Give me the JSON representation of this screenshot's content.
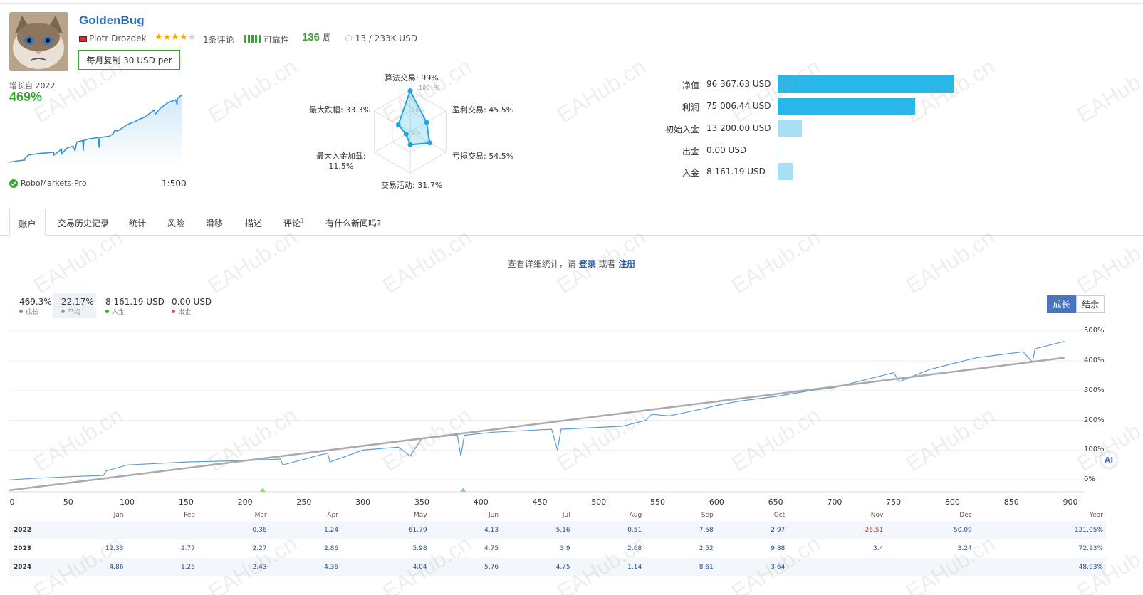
{
  "profile": {
    "title": "GoldenBug",
    "author": "Piotr Drozdek",
    "rating": 3.5,
    "reviews": "1条评论",
    "reliability_label": "可靠性",
    "weeks": "136",
    "weeks_unit": "周",
    "subscribers": "13 / 233K USD",
    "subscribe_label": "每月复制 30 USD per",
    "growth_since": "增长自 2022",
    "growth_value": "469%",
    "broker": "RoboMarkets-Pro",
    "leverage": "1:500"
  },
  "radar": {
    "algo": "算法交易: 99%",
    "profit_trades": "盈利交易: 45.5%",
    "loss_trades": "亏损交易: 54.5%",
    "activity": "交易活动: 31.7%",
    "max_load_a": "最大入金加载:",
    "max_load_b": "11.5%",
    "max_drawdown": "最大跌幅: 33.3%",
    "ring_100": "100+%",
    "ring_50": "50%",
    "ring_0": "0%",
    "values": [
      0.99,
      0.455,
      0.545,
      0.317,
      0.115,
      0.333
    ]
  },
  "stats": [
    {
      "label": "净值",
      "value": "96 367.63 USD",
      "amount": 96367.63,
      "color": "#29b6e8"
    },
    {
      "label": "利润",
      "value": "75 006.44 USD",
      "amount": 75006.44,
      "color": "#29b6e8"
    },
    {
      "label": "初始入金",
      "value": "13 200.00 USD",
      "amount": 13200.0,
      "color": "#a8dff5"
    },
    {
      "label": "出金",
      "value": "0.00 USD",
      "amount": 0,
      "color": "#a8dff5"
    },
    {
      "label": "入金",
      "value": "8 161.19 USD",
      "amount": 8161.19,
      "color": "#a8dff5"
    }
  ],
  "tabs": [
    "账户",
    "交易历史记录",
    "统计",
    "风险",
    "滑移",
    "描述",
    "评论",
    "有什么新闻吗?"
  ],
  "tab_badge": "1",
  "login_note": {
    "pre": "查看详细统计，请 ",
    "login": "登录",
    "mid": " 或者 ",
    "register": "注册"
  },
  "chart_legend": [
    {
      "value": "469.3%",
      "key": "成长",
      "color": "#6b8fd6"
    },
    {
      "value": "22.17%",
      "key": "平均",
      "color": "#999999"
    },
    {
      "value": "8 161.19 USD",
      "key": "入金",
      "color": "#3aa437"
    },
    {
      "value": "0.00 USD",
      "key": "出金",
      "color": "#e04a3a"
    }
  ],
  "chart_toggle": {
    "growth": "成长",
    "balance": "结余"
  },
  "chart_data": {
    "type": "line",
    "x_ticks": [
      "0",
      "50",
      "100",
      "150",
      "200",
      "250",
      "300",
      "350",
      "400",
      "450",
      "500",
      "550",
      "600",
      "650",
      "700",
      "750",
      "800",
      "850",
      "900"
    ],
    "y_ticks": [
      "500%",
      "400%",
      "300%",
      "200%",
      "100%",
      "0%"
    ],
    "xlim": [
      0,
      900
    ],
    "ylim": [
      -40,
      500
    ],
    "series": [
      {
        "name": "成长",
        "x": [
          0,
          20,
          60,
          80,
          82,
          100,
          150,
          170,
          200,
          230,
          232,
          260,
          270,
          272,
          300,
          330,
          340,
          350,
          380,
          383,
          386,
          410,
          460,
          465,
          468,
          520,
          540,
          545,
          560,
          590,
          600,
          620,
          650,
          680,
          700,
          720,
          740,
          750,
          755,
          780,
          800,
          820,
          840,
          860,
          868,
          870,
          880,
          890,
          895
        ],
        "y": [
          0,
          5,
          12,
          15,
          30,
          50,
          60,
          62,
          65,
          70,
          50,
          80,
          90,
          60,
          100,
          110,
          80,
          140,
          150,
          80,
          150,
          160,
          170,
          100,
          170,
          180,
          200,
          220,
          215,
          240,
          250,
          265,
          280,
          300,
          310,
          330,
          350,
          360,
          330,
          370,
          390,
          410,
          420,
          430,
          395,
          440,
          450,
          460,
          465
        ]
      },
      {
        "name": "平均",
        "x": [
          0,
          895
        ],
        "y": [
          -35,
          410
        ]
      }
    ],
    "markers_x": [
      215,
      385
    ]
  },
  "monthly": {
    "headers": [
      "",
      "Jan",
      "Feb",
      "Mar",
      "Apr",
      "May",
      "Jun",
      "Jul",
      "Aug",
      "Sep",
      "Oct",
      "Nov",
      "Dec",
      "Year"
    ],
    "rows": [
      [
        "2022",
        "",
        "",
        "0.36",
        "1.24",
        "61.79",
        "4.13",
        "5.16",
        "0.51",
        "7.58",
        "2.97",
        "-26.51",
        "50.09",
        "121.05%"
      ],
      [
        "2023",
        "12.33",
        "2.77",
        "2.27",
        "2.86",
        "5.98",
        "4.75",
        "3.9",
        "2.68",
        "2.52",
        "9.88",
        "3.4",
        "3.24",
        "72.93%"
      ],
      [
        "2024",
        "4.86",
        "1.25",
        "2.43",
        "4.36",
        "4.04",
        "5.76",
        "4.75",
        "1.14",
        "8.61",
        "3.64",
        "",
        "",
        "48.93%"
      ]
    ]
  },
  "watermark": "EAHub.cn"
}
